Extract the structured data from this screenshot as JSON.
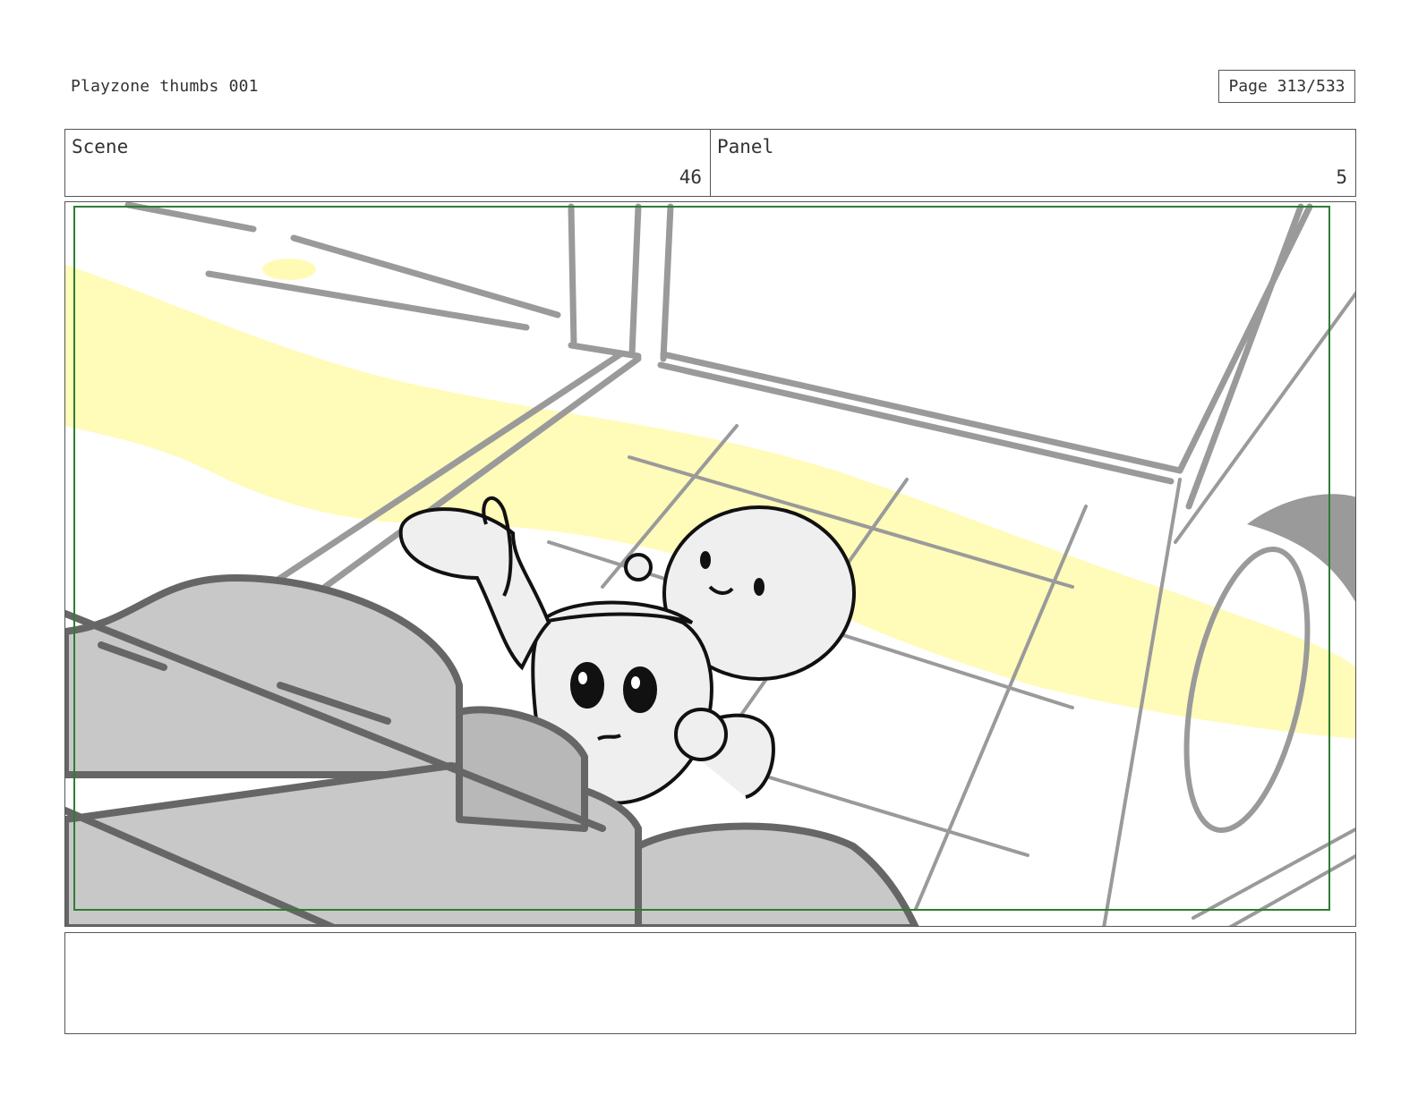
{
  "document": {
    "title": "Playzone thumbs 001",
    "page_label": "Page 313/533"
  },
  "header": {
    "scene_label": "Scene",
    "scene_value": "46",
    "panel_label": "Panel",
    "panel_value": "5"
  },
  "panel": {
    "description": "",
    "colors": {
      "safe_frame": "#2e7d32",
      "sketch_gray": "#9a9a9a",
      "seat_fill": "#c8c8c8",
      "seat_stroke": "#666666",
      "highlight_yellow": "#fffbb5",
      "ink": "#111111"
    }
  },
  "notes": {
    "text": ""
  }
}
